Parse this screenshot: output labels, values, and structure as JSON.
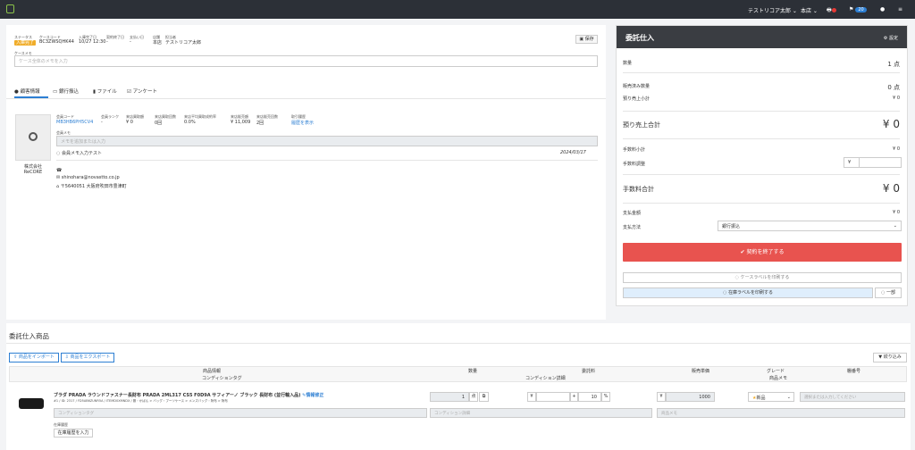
{
  "topbar": {
    "user": "テストリコア太郎 ⌄",
    "store": "本店 ⌄",
    "notice_count": "20"
  },
  "case": {
    "status_label": "ステータス",
    "status": "入庫完了",
    "code_label": "ケースコード",
    "code": "BC3ZWSQHK44",
    "date_label": "入庫完了日",
    "date": "10/27 12:30",
    "contract_label": "契約終了日",
    "contract": "-",
    "payment_label": "支払い日",
    "payment": "-",
    "store_label": "店舗",
    "store": "本店",
    "staff_label": "担当者",
    "staff": "テストリコア太郎",
    "save_label": "保存",
    "memo_label": "ケースメモ",
    "memo_placeholder": "ケース全体のメモを入力"
  },
  "tabs": [
    "顧客情報",
    "銀行振込",
    "ファイル",
    "アンケート"
  ],
  "customer": {
    "name": "株式会社\nReCORE",
    "fields": [
      {
        "label": "会員コード",
        "value": "MB3HB6PH5CV4",
        "link": true
      },
      {
        "label": "会員ランク",
        "value": "-"
      },
      {
        "label": "来店買取額",
        "value": "¥ 0"
      },
      {
        "label": "来店買取回数",
        "value": "0回"
      },
      {
        "label": "来店平均買取成約率",
        "value": "0.0%"
      },
      {
        "label": "来店販売額",
        "value": "¥ 11,009"
      },
      {
        "label": "来店販売回数",
        "value": "2回"
      },
      {
        "label": "取引履歴",
        "value": "履歴を表示",
        "link": true
      }
    ],
    "memo_label": "会員メモ",
    "memo_placeholder": "メモを追加または入力",
    "memo_text": "会員メモ入力テスト",
    "memo_date": "2024/03/17",
    "email": "shinohara@novastto.co.jp",
    "address": "〒5640051 大阪府吹田市豊津町"
  },
  "right": {
    "title": "委託仕入",
    "settings": "設定",
    "qty_label": "数量",
    "qty": "1 点",
    "sold_label": "販売済み数量",
    "sold": "0 点",
    "presale_label": "預り売上小計",
    "presale": "¥ 0",
    "presale_total_label": "預り売上合計",
    "presale_total": "¥ 0",
    "fee_label": "手数料小計",
    "fee": "¥ 0",
    "fee_adj_label": "手数料調整",
    "yen": "¥",
    "fee_total_label": "手数料合計",
    "fee_total": "¥ 0",
    "pay_amount_label": "支払金額",
    "pay_amount": "¥ 0",
    "pay_method_label": "支払方法",
    "pay_method": "銀行振込",
    "end_label": "✔ 契約を終了する",
    "print_case": "ケースラベルを印刷する",
    "print_stock": "在庫ラベルを印刷する",
    "batch": "一部"
  },
  "products": {
    "title": "委託仕入商品",
    "import": "商品をインポート",
    "export": "商品をエクスポート",
    "filter": "絞り込み",
    "headers": [
      "商品情報",
      "数量",
      "委託料",
      "販売単価",
      "グレード",
      "棚番号"
    ],
    "subheaders": [
      "コンディションタグ",
      "コンディション詳細",
      "商品メモ"
    ],
    "item": {
      "name": "ブラダ PRADA ラウンドファスナー長財布 PRADA 2ML317 CS5 F0D9A サフィアーノ ブラック 長財布 (並行輸入品)",
      "edit": "情報修正",
      "meta": "#1 / ID: 2317 / FD5AB6ZUNR5A / ITEMD0XMNDX / 服・かばん > バッグ・ブーツケース > メンズバッグ・財布 > 財布",
      "qty": "1",
      "qty_unit": "点",
      "fee_unit": "¥",
      "fee_plus": "+",
      "fee_pct": "10",
      "pct": "%",
      "price_yen": "¥",
      "price": "1000",
      "grade": "新品",
      "shelf_placeholder": "選択または入力してください",
      "tag_placeholder": "コンディションタグ",
      "cond_placeholder": "コンディション詳細",
      "memo_placeholder": "商品メモ",
      "stock_label": "在庫履歴",
      "stock_btn": "在庫履歴を入力"
    }
  }
}
